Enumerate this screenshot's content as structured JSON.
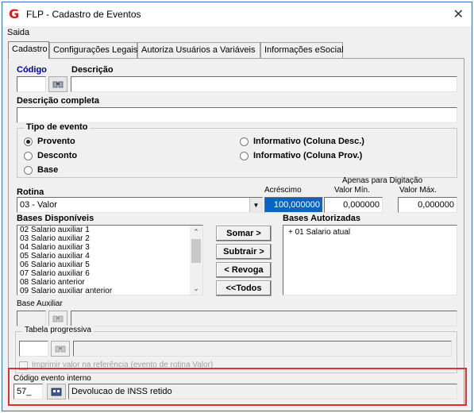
{
  "window": {
    "title": "FLP - Cadastro de Eventos",
    "close": "✕",
    "app_icon": "G"
  },
  "menu": {
    "items": [
      "Saida"
    ]
  },
  "tabs": [
    "Cadastro",
    "Configurações Legais",
    "Autoriza Usuários a Variáveis",
    "Informações eSocial"
  ],
  "codigo": {
    "label": "Código",
    "value": ""
  },
  "descricao": {
    "label": "Descrição",
    "value": ""
  },
  "descricao_completa": {
    "label": "Descrição completa",
    "value": ""
  },
  "tipo_evento": {
    "title": "Tipo de evento",
    "options": [
      "Provento",
      "Desconto",
      "Base",
      "Informativo (Coluna Desc.)",
      "Informativo (Coluna Prov.)"
    ],
    "selected": "Provento"
  },
  "rotina": {
    "label": "Rotina",
    "value": "03 - Valor"
  },
  "apenas_digitacao": "Apenas para Digitação",
  "acrescimo": {
    "label": "Acréscimo",
    "value": "100,000000"
  },
  "valor_min": {
    "label": "Valor Mín.",
    "value": "0,000000"
  },
  "valor_max": {
    "label": "Valor Máx.",
    "value": "0,000000"
  },
  "bases_disponiveis": {
    "label": "Bases Disponíveis",
    "items": [
      "02 Salario auxiliar 1",
      "03 Salario auxiliar 2",
      "04 Salario auxiliar 3",
      "05 Salario auxiliar 4",
      "06 Salario auxiliar 5",
      "07 Salario auxiliar 6",
      "08 Salario anterior",
      "09 Salario auxiliar anterior"
    ]
  },
  "bases_autorizadas": {
    "label": "Bases Autorizadas",
    "items": [
      "+ 01 Salario atual"
    ]
  },
  "buttons": {
    "somar": "Somar >",
    "subtrair": "Subtrair >",
    "revoga": "< Revoga",
    "todos": "<<Todos"
  },
  "base_auxiliar": {
    "label": "Base Auxiliar",
    "value": ""
  },
  "tabela_progressiva": {
    "label": "Tabela progressiva",
    "value": ""
  },
  "imprimir_checkbox": "Imprimir valor na referência (evento de rotina Valor)",
  "codigo_evento_interno": {
    "label": "Código evento interno",
    "code": "57_",
    "description": "Devolucao de INSS retido"
  },
  "colors": {
    "accent_highlight": "#e03030",
    "window_border": "#2b73d6",
    "selection": "#0a64c8"
  }
}
